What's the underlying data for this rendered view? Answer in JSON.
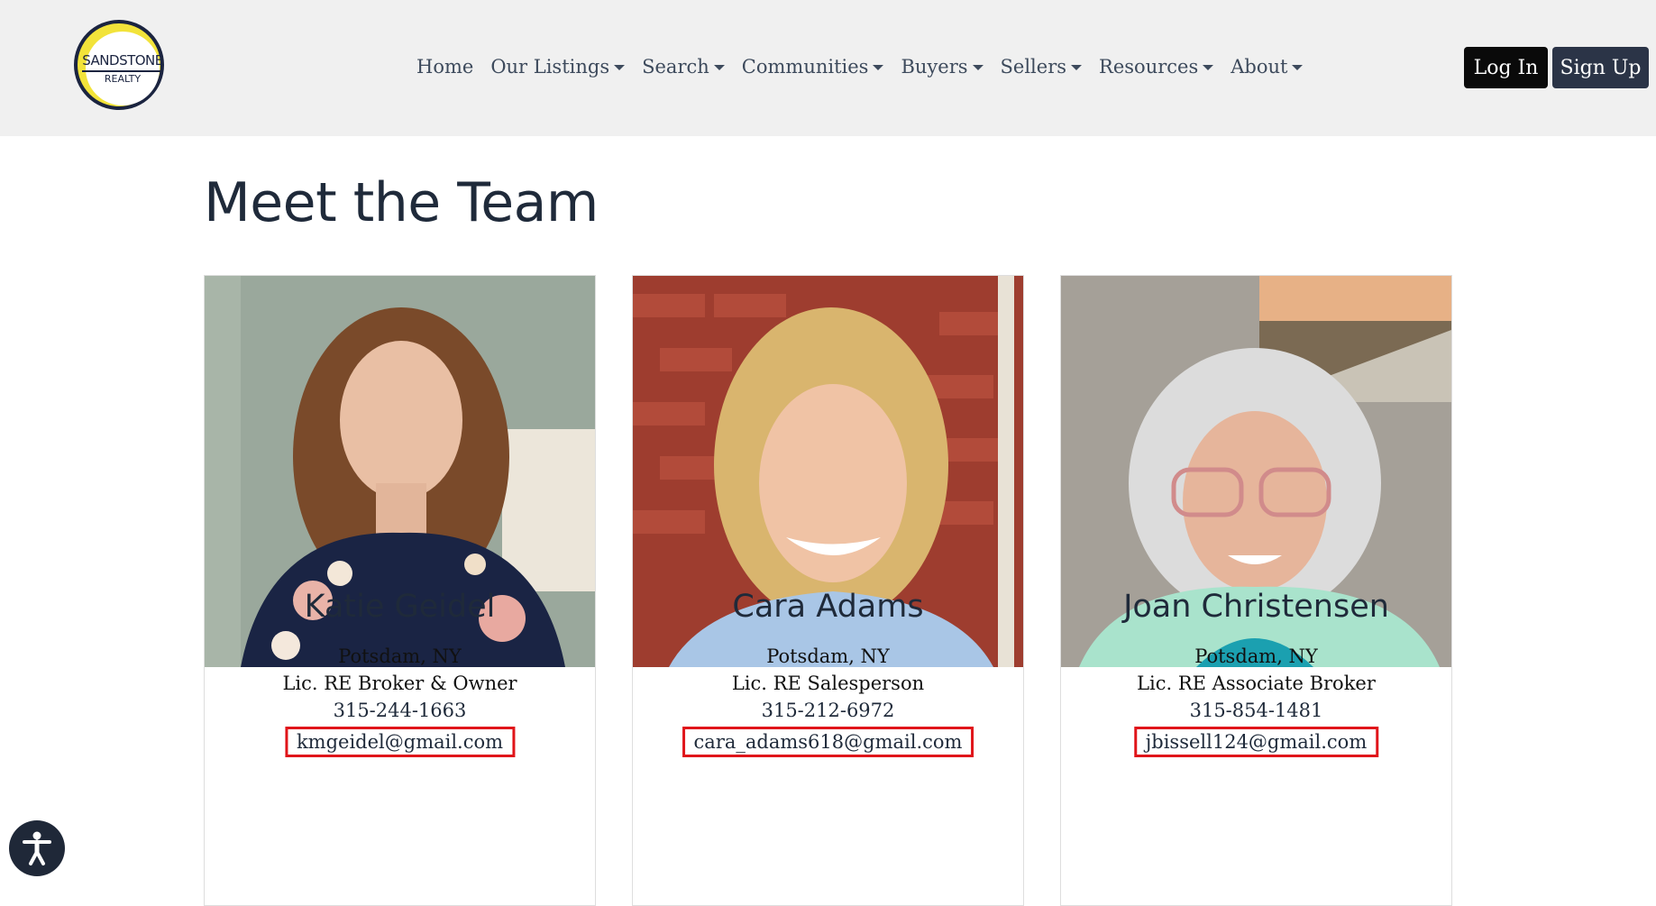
{
  "logo": {
    "line1": "SANDSTONE",
    "line2": "REALTY"
  },
  "nav": [
    {
      "label": "Home",
      "dropdown": false
    },
    {
      "label": "Our Listings",
      "dropdown": true
    },
    {
      "label": "Search",
      "dropdown": true
    },
    {
      "label": "Communities",
      "dropdown": true
    },
    {
      "label": "Buyers",
      "dropdown": true
    },
    {
      "label": "Sellers",
      "dropdown": true
    },
    {
      "label": "Resources",
      "dropdown": true
    },
    {
      "label": "About",
      "dropdown": true
    }
  ],
  "auth": {
    "login": "Log In",
    "signup": "Sign Up"
  },
  "page": {
    "title": "Meet the Team"
  },
  "team": [
    {
      "name": "Katie Geidel",
      "location": "Potsdam, NY",
      "role": "Lic. RE Broker & Owner",
      "phone": "315-244-1663",
      "email": "kmgeidel@gmail.com"
    },
    {
      "name": "Cara Adams",
      "location": "Potsdam, NY",
      "role": "Lic. RE Salesperson",
      "phone": "315-212-6972",
      "email": "cara_adams618@gmail.com"
    },
    {
      "name": "Joan Christensen",
      "location": "Potsdam, NY",
      "role": "Lic. RE Associate Broker",
      "phone": "315-854-1481",
      "email": "jbissell124@gmail.com"
    }
  ],
  "colors": {
    "accent": "#e0151a",
    "dark": "#1f2838",
    "logo_ring": "#f2e33a"
  },
  "icons": {
    "accessibility": "accessibility-icon"
  }
}
